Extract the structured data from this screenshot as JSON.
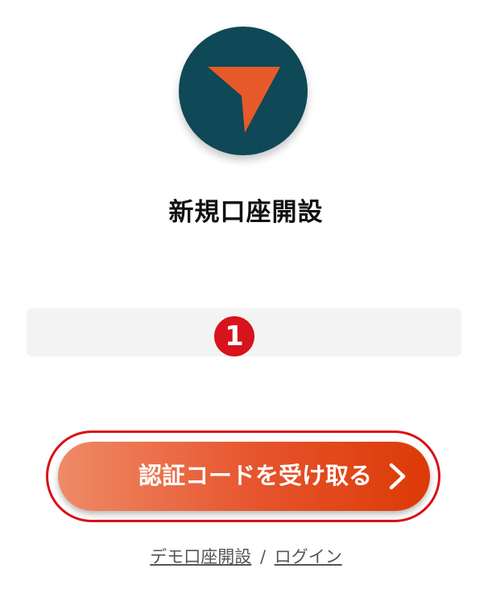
{
  "page": {
    "title": "新規口座開設"
  },
  "form": {
    "input_placeholder": "",
    "step_number": "1"
  },
  "actions": {
    "submit_label": "認証コードを受け取る",
    "demo_link_label": "デモ口座開設",
    "separator": "/",
    "login_link_label": "ログイン"
  },
  "colors": {
    "logo_bg": "#0f4856",
    "logo_arrow": "#e85a2a",
    "button_gradient_start": "#ef8a67",
    "button_gradient_end": "#dc3a06",
    "highlight": "#d90f17"
  },
  "icons": {
    "logo": "paper-plane-arrow-icon",
    "button_arrow": "chevron-right-icon"
  }
}
